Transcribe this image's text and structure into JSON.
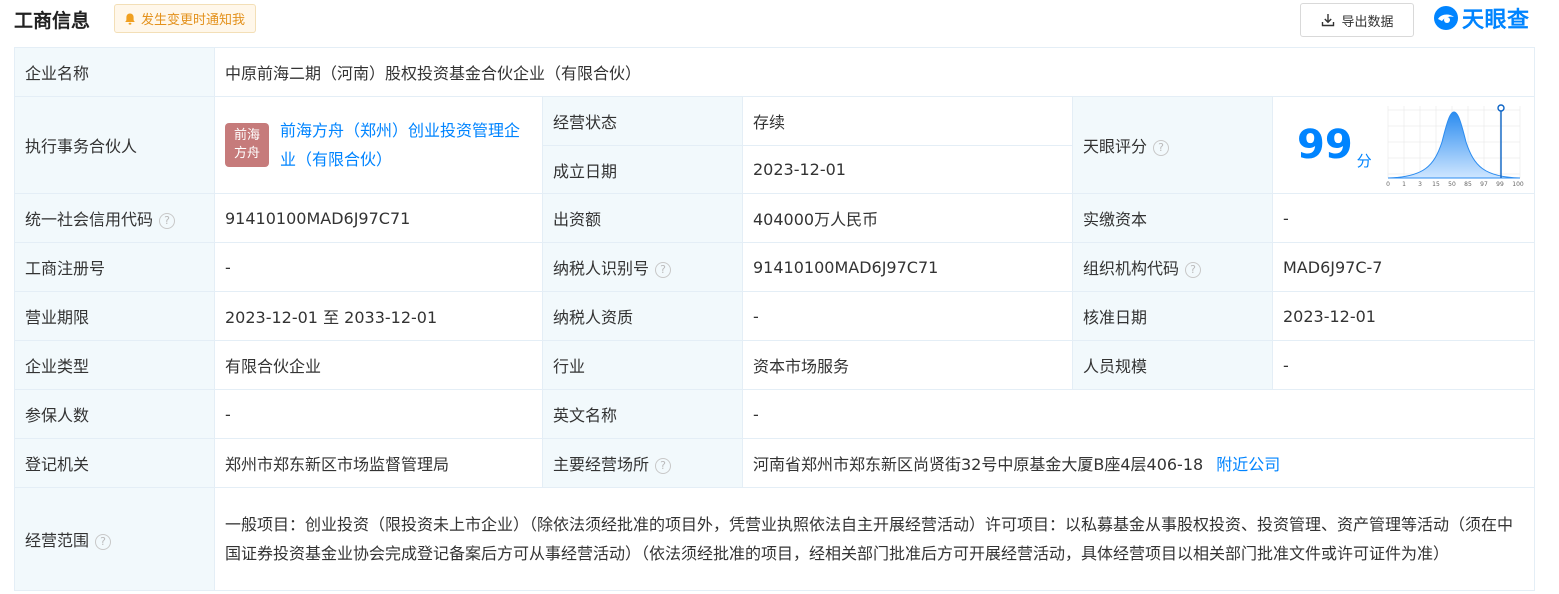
{
  "header": {
    "title": "工商信息",
    "notify_label": "发生变更时通知我",
    "export_label": "导出数据",
    "brand_name": "天眼查"
  },
  "colors": {
    "accent": "#0084ff",
    "status_green": "#009944",
    "label_bg": "#f2f9fc",
    "partner_logo_bg": "#c67b7b"
  },
  "rows": {
    "company_name": {
      "label": "企业名称",
      "value": "中原前海二期（河南）股权投资基金合伙企业（有限合伙）"
    },
    "partner": {
      "label": "执行事务合伙人",
      "logo_line1": "前海",
      "logo_line2": "方舟",
      "value": "前海方舟（郑州）创业投资管理企业（有限合伙）"
    },
    "status": {
      "label": "经营状态",
      "value": "存续"
    },
    "established": {
      "label": "成立日期",
      "value": "2023-12-01"
    },
    "score": {
      "label": "天眼评分",
      "value": "99",
      "unit": "分",
      "axis_ticks": [
        "0",
        "1",
        "3",
        "15",
        "50",
        "85",
        "97",
        "99",
        "100"
      ]
    },
    "credit_code": {
      "label": "统一社会信用代码",
      "value": "91410100MAD6J97C71"
    },
    "capital": {
      "label": "出资额",
      "value": "404000万人民币"
    },
    "paid_capital": {
      "label": "实缴资本",
      "value": "-"
    },
    "reg_no": {
      "label": "工商注册号",
      "value": "-"
    },
    "tax_id": {
      "label": "纳税人识别号",
      "value": "91410100MAD6J97C71"
    },
    "org_code": {
      "label": "组织机构代码",
      "value": "MAD6J97C-7"
    },
    "term": {
      "label": "营业期限",
      "value": "2023-12-01 至 2033-12-01"
    },
    "tax_qual": {
      "label": "纳税人资质",
      "value": "-"
    },
    "approve_date": {
      "label": "核准日期",
      "value": "2023-12-01"
    },
    "type": {
      "label": "企业类型",
      "value": "有限合伙企业"
    },
    "industry": {
      "label": "行业",
      "value": "资本市场服务"
    },
    "staff": {
      "label": "人员规模",
      "value": "-"
    },
    "insured": {
      "label": "参保人数",
      "value": "-"
    },
    "eng_name": {
      "label": "英文名称",
      "value": "-"
    },
    "authority": {
      "label": "登记机关",
      "value": "郑州市郑东新区市场监督管理局"
    },
    "address": {
      "label": "主要经营场所",
      "value": "河南省郑州市郑东新区尚贤街32号中原基金大厦B座4层406-18",
      "link": "附近公司"
    },
    "scope": {
      "label": "经营范围",
      "value": "一般项目：创业投资（限投资未上市企业）（除依法须经批准的项目外，凭营业执照依法自主开展经营活动）许可项目：以私募基金从事股权投资、投资管理、资产管理等活动（须在中国证券投资基金业协会完成登记备案后方可从事经营活动）（依法须经批准的项目，经相关部门批准后方可开展经营活动，具体经营项目以相关部门批准文件或许可证件为准）"
    }
  }
}
